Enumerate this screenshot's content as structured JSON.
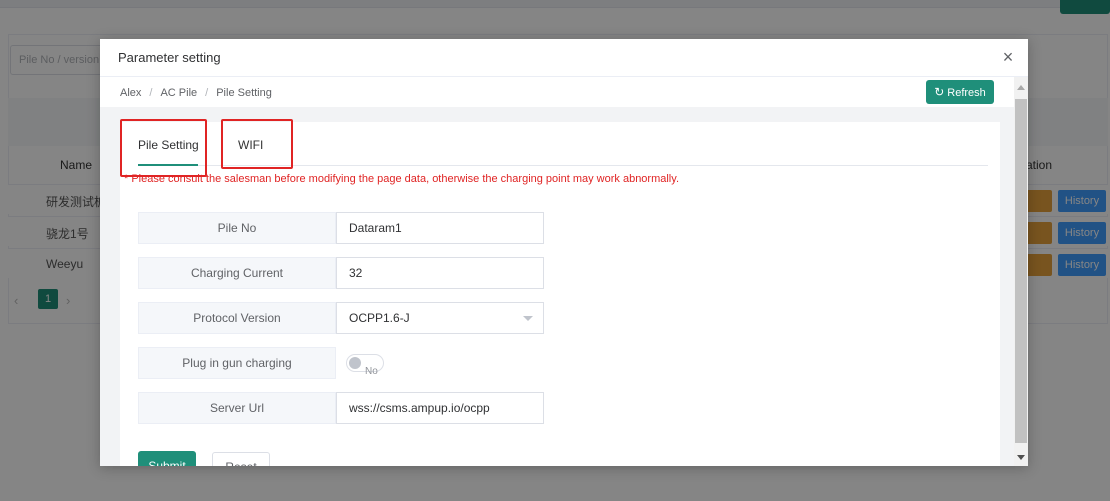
{
  "background": {
    "search_placeholder": "Pile No / version",
    "table": {
      "col_name": "Name",
      "col_operation": "ation",
      "rows": [
        {
          "name": "研发测试桩"
        },
        {
          "name": "骁龙1号"
        },
        {
          "name": "Weeyu"
        }
      ],
      "history_label": "History"
    },
    "pagination": {
      "current_page": "1"
    },
    "accent_color": "#1f8f7a"
  },
  "modal": {
    "title": "Parameter setting",
    "breadcrumb": [
      "Alex",
      "AC Pile",
      "Pile Setting"
    ],
    "refresh_label": "Refresh",
    "tabs": [
      {
        "label": "Pile Setting",
        "active": true
      },
      {
        "label": "WIFI",
        "active": false
      }
    ],
    "warning": "* Please consult the salesman before modifying the page data, otherwise the charging point may work abnormally.",
    "form": {
      "pile_no": {
        "label": "Pile No",
        "value": "Dataram1"
      },
      "charging_current": {
        "label": "Charging Current",
        "value": "32"
      },
      "protocol_version": {
        "label": "Protocol Version",
        "value": "OCPP1.6-J"
      },
      "plug_in_gun_charging": {
        "label": "Plug in gun charging",
        "value": "No",
        "enabled": false
      },
      "server_url": {
        "label": "Server Url",
        "value": "wss://csms.ampup.io/ocpp"
      }
    },
    "submit_label": "Submit",
    "reset_label": "Reset"
  },
  "colors": {
    "primary": "#1f8f7a",
    "warning_text": "#e02424",
    "highlight_box": "#e02424",
    "history_button": "#409eff",
    "edit_button": "#e6a23c"
  }
}
